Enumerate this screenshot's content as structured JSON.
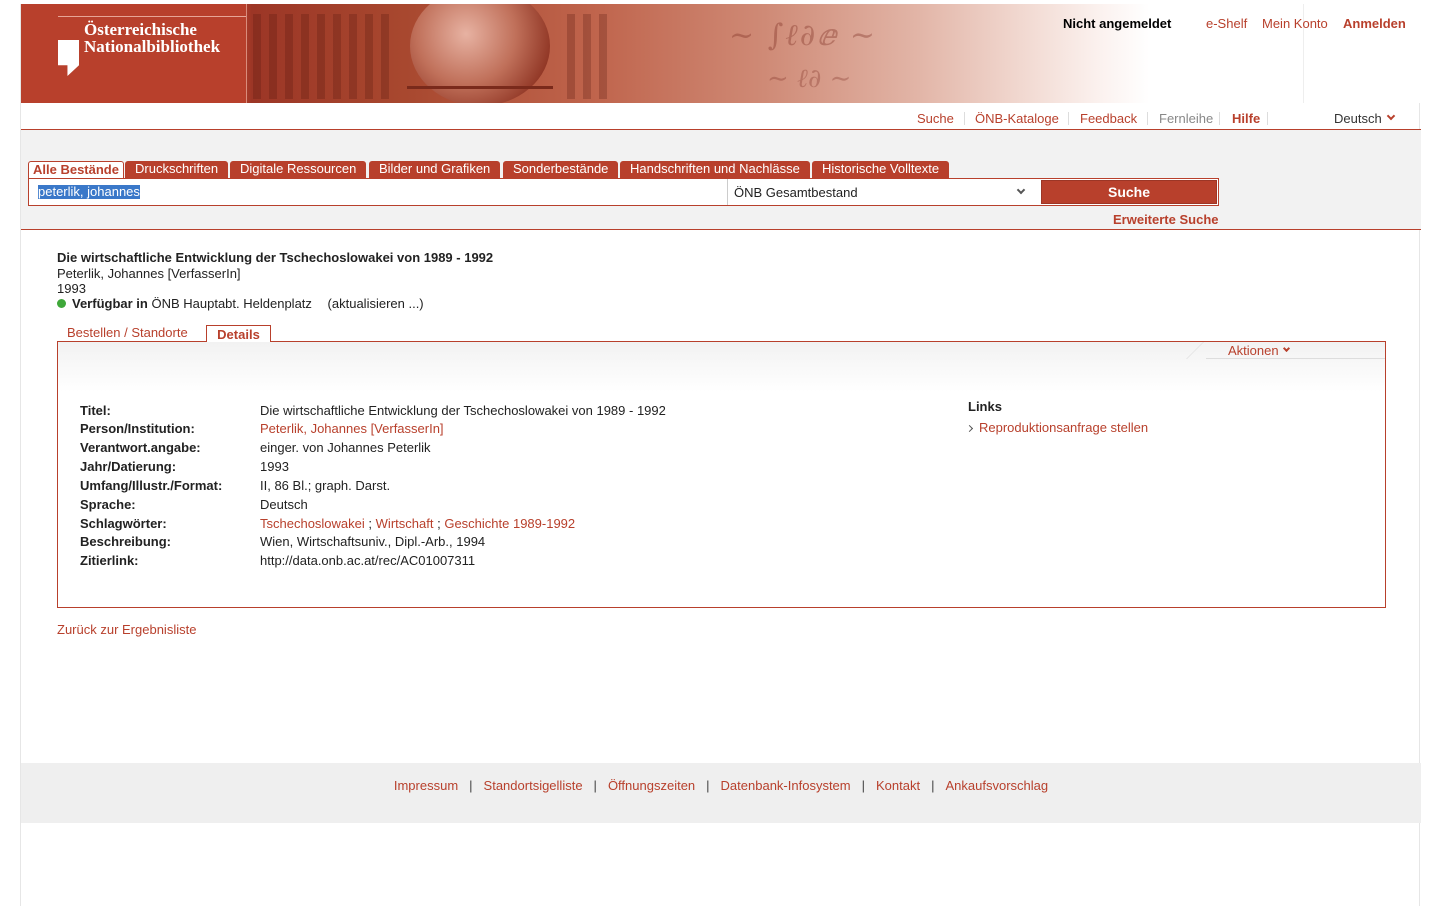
{
  "banner": {
    "logo_line1": "Österreichische",
    "logo_line2": "Nationalbibliothek",
    "user_status": "Nicht angemeldet",
    "links": {
      "eshelf": "e-Shelf",
      "konto": "Mein Konto",
      "anmelden": "Anmelden"
    }
  },
  "nav": {
    "items": [
      "Suche",
      "ÖNB-Kataloge",
      "Feedback",
      "Fernleihe",
      "Hilfe"
    ],
    "language": "Deutsch"
  },
  "search": {
    "tabs": [
      "Alle Bestände",
      "Druckschriften",
      "Digitale Ressourcen",
      "Bilder und Grafiken",
      "Sonderbestände",
      "Handschriften und Nachlässe",
      "Historische Volltexte"
    ],
    "active_tab": "Alle Bestände",
    "query": "peterlik, johannes",
    "scope": "ÖNB Gesamtbestand",
    "button": "Suche",
    "advanced": "Erweiterte Suche"
  },
  "record": {
    "title": "Die wirtschaftliche Entwicklung der Tschechoslowakei von 1989 - 1992",
    "author": "Peterlik, Johannes [VerfasserIn]",
    "year": "1993",
    "availability_label": "Verfügbar in",
    "availability_location": "ÖNB Hauptabt. Heldenplatz",
    "availability_refresh": "(aktualisieren ...)",
    "status_color": "#3fa83a"
  },
  "detail_tabs": {
    "bestellen": "Bestellen / Standorte",
    "details": "Details"
  },
  "actions_label": "Aktionen",
  "fields": {
    "titel": {
      "label": "Titel:",
      "value": "Die wirtschaftliche Entwicklung der Tschechoslowakei von 1989 - 1992"
    },
    "person": {
      "label": "Person/Institution:",
      "value": "Peterlik, Johannes [VerfasserIn]"
    },
    "verantwort": {
      "label": "Verantwort.angabe:",
      "value": "einger. von Johannes Peterlik"
    },
    "jahr": {
      "label": "Jahr/Datierung:",
      "value": "1993"
    },
    "umfang": {
      "label": "Umfang/Illustr./Format:",
      "value": "II, 86 Bl.; graph. Darst."
    },
    "sprache": {
      "label": "Sprache:",
      "value": "Deutsch"
    },
    "schlagwoerter": {
      "label": "Schlagwörter:",
      "values": [
        "Tschechoslowakei",
        "Wirtschaft",
        "Geschichte 1989-1992"
      ],
      "separator": ";"
    },
    "beschreibung": {
      "label": "Beschreibung:",
      "value": "Wien, Wirtschaftsuniv., Dipl.-Arb., 1994"
    },
    "zitierlink": {
      "label": "Zitierlink:",
      "value": "http://data.onb.ac.at/rec/AC01007311"
    }
  },
  "links_box": {
    "heading": "Links",
    "items": [
      "Reproduktionsanfrage stellen"
    ]
  },
  "back_link": "Zurück zur Ergebnisliste",
  "footer": {
    "links": [
      "Impressum",
      "Standortsigelliste",
      "Öffnungszeiten",
      "Datenbank-Infosystem",
      "Kontakt",
      "Ankaufsvorschlag"
    ],
    "separator": "|"
  },
  "colors": {
    "accent": "#b8402c",
    "available": "#3fa83a",
    "selection": "#3a78c9"
  }
}
